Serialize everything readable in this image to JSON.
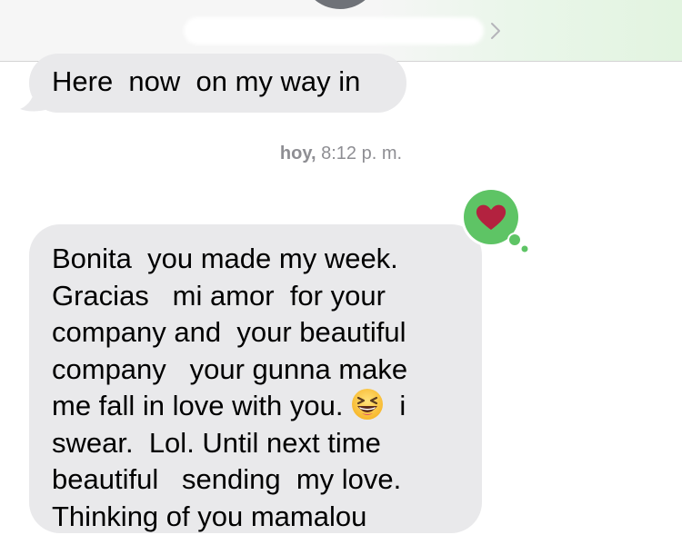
{
  "header": {
    "contact_name": "",
    "avatar_color": "#6f7278",
    "chevron_icon": "chevron-right-icon"
  },
  "messages": [
    {
      "direction": "incoming",
      "text": "Here  now  on my way in"
    },
    {
      "direction": "incoming",
      "lines": [
        "Bonita  you made my week.",
        "Gracias   mi amor  for your",
        "company and  your beautiful",
        "company   your gunna make",
        "me fall in love with you.",
        "swear.  Lol. Until next time",
        "beautiful   sending  my love.",
        "Thinking of you mamalou"
      ],
      "line5_after_emoji": "  i",
      "inline_emoji": "grinning-squinting-face-icon",
      "reaction": {
        "icon": "heart-icon",
        "bubble_color": "#5ec465",
        "heart_color": "#b3223f"
      }
    }
  ],
  "timestamp": {
    "day": "hoy,",
    "time": " 8:12 p. m."
  },
  "colors": {
    "incoming_bubble": "#e9e9eb",
    "timestamp_text": "#8e8e93"
  }
}
